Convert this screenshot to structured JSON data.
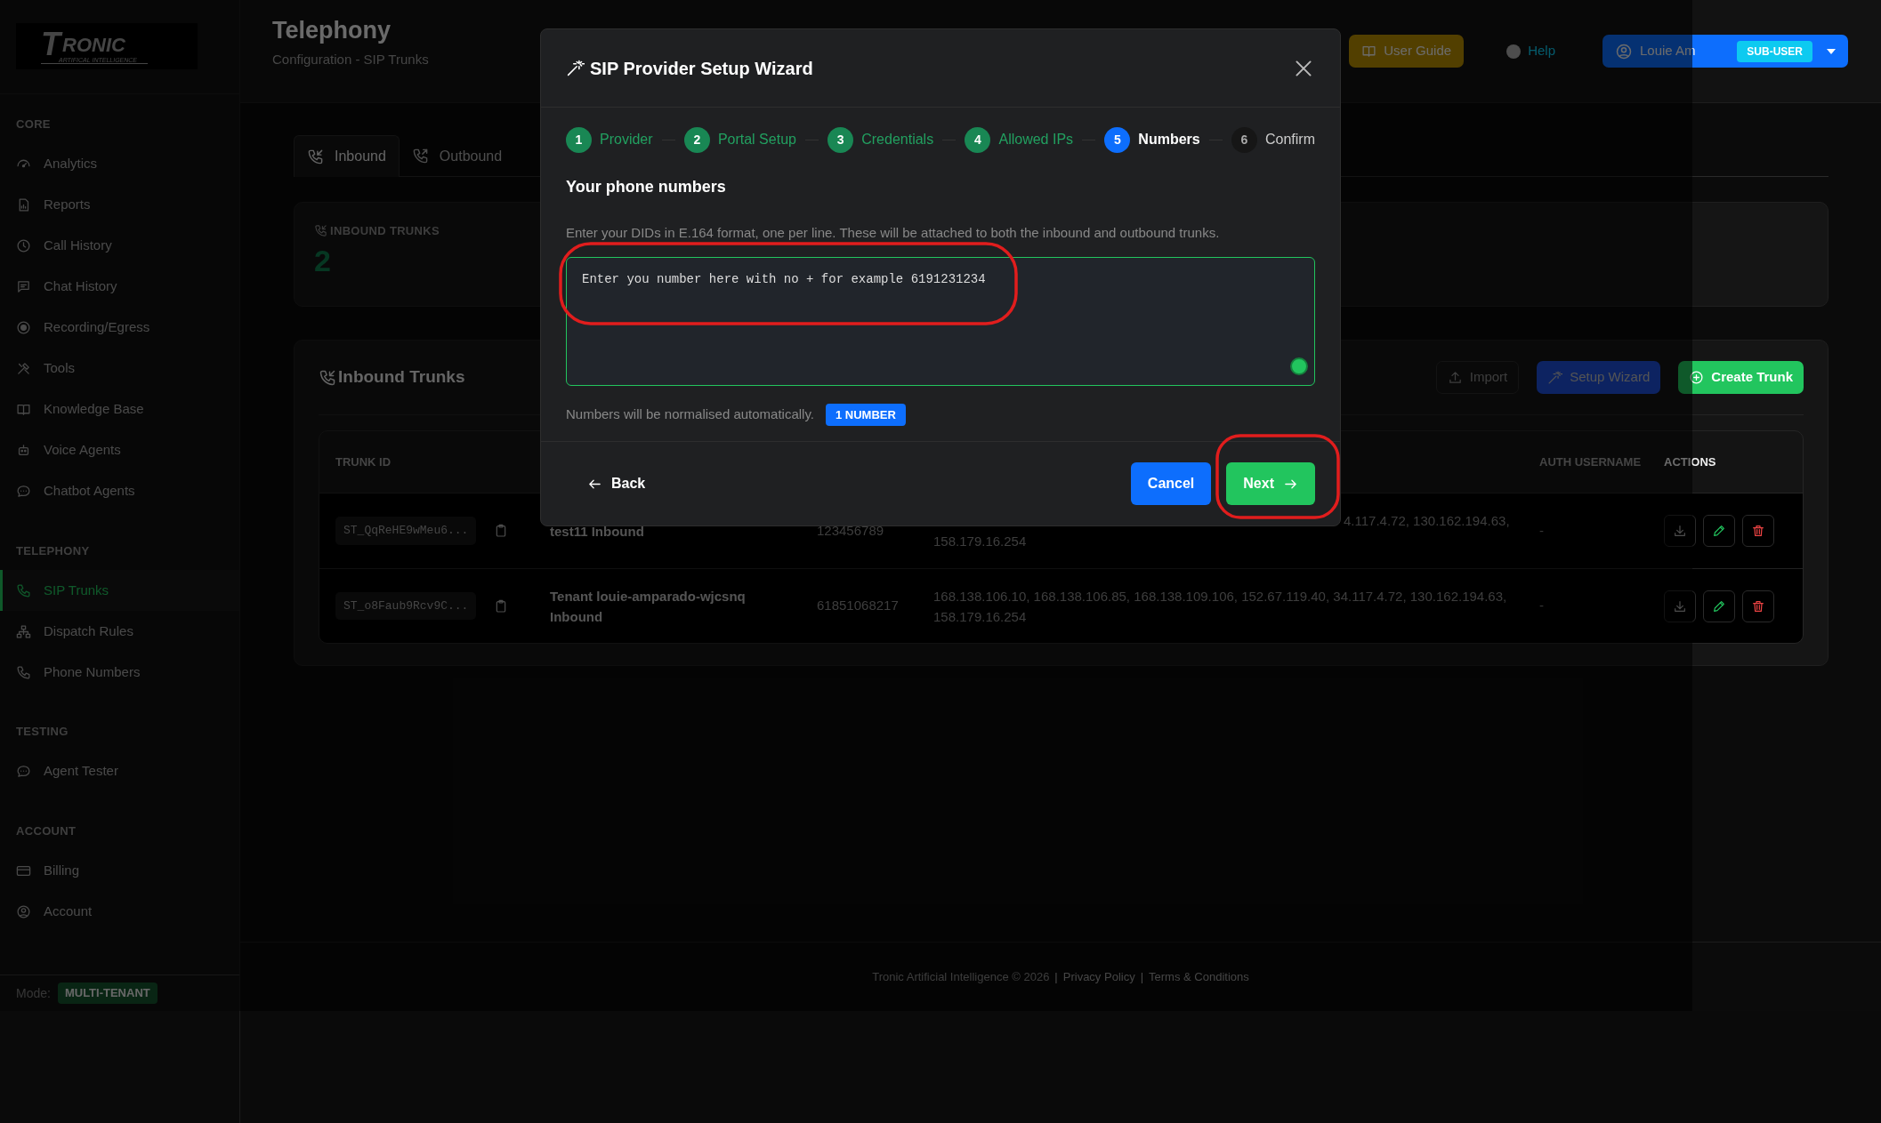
{
  "sidebar": {
    "logo_mark": "T",
    "logo_text": "RONIC",
    "logo_subtext": "ARTIFICAL INTELLIGENCE",
    "sections": [
      {
        "title": "CORE",
        "items": [
          {
            "label": "Analytics",
            "selected": false
          },
          {
            "label": "Reports",
            "selected": false
          },
          {
            "label": "Call History",
            "selected": false
          },
          {
            "label": "Chat History",
            "selected": false
          },
          {
            "label": "Recording/Egress",
            "selected": false
          },
          {
            "label": "Tools",
            "selected": false
          },
          {
            "label": "Knowledge Base",
            "selected": false
          },
          {
            "label": "Voice Agents",
            "selected": false
          },
          {
            "label": "Chatbot Agents",
            "selected": false
          }
        ]
      },
      {
        "title": "TELEPHONY",
        "items": [
          {
            "label": "SIP Trunks",
            "selected": true
          },
          {
            "label": "Dispatch Rules",
            "selected": false
          },
          {
            "label": "Phone Numbers",
            "selected": false
          }
        ]
      },
      {
        "title": "TESTING",
        "items": [
          {
            "label": "Agent Tester",
            "selected": false
          }
        ]
      },
      {
        "title": "ACCOUNT",
        "items": [
          {
            "label": "Billing",
            "selected": false
          },
          {
            "label": "Account",
            "selected": false
          }
        ]
      }
    ],
    "mode_label": "Mode:",
    "mode_badge": "MULTI-TENANT"
  },
  "header": {
    "title": "Telephony",
    "subtitle": "Configuration - SIP Trunks",
    "user_guide": "User Guide",
    "help": "Help",
    "user_name": "Louie Am",
    "role_badge": "SUB-USER"
  },
  "tabs": [
    {
      "label": "Inbound",
      "selected": true
    },
    {
      "label": "Outbound",
      "selected": false
    }
  ],
  "stat": {
    "label": "INBOUND TRUNKS",
    "value": "2"
  },
  "trunks_panel": {
    "title": "Inbound Trunks",
    "buttons": [
      {
        "kind": "outline",
        "label": "Import"
      },
      {
        "kind": "secondary",
        "label": "Setup Wizard"
      },
      {
        "kind": "primary",
        "label": "Create Trunk"
      }
    ],
    "table": {
      "columns": {
        "trunk_id": "TRUNK ID",
        "auth_username": "AUTH USERNAME",
        "actions": "ACTIONS"
      },
      "rows": [
        {
          "trunk_id": "ST_QqReHE9wMeu6...",
          "name": "test11 Inbound",
          "number": "123456789",
          "covered": true,
          "ip_lines": [
            "4.117.4.72, 130.162.194.63,",
            "158.179.16.254"
          ],
          "auth_username": "-"
        },
        {
          "trunk_id": "ST_o8Faub9Rcv9C...",
          "name": "Tenant louie-amparado-wjcsnq Inbound",
          "number": "61851068217",
          "covered": false,
          "ip_lines": [
            "168.138.106.10, 168.138.106.85, 168.138.109.106, 152.67.119.40, 34.117.4.72, 130.162.194.63,",
            "158.179.16.254"
          ],
          "auth_username": "-"
        }
      ]
    }
  },
  "footer": [
    {
      "kind": "text",
      "label": "Tronic Artificial Intelligence © 2026"
    },
    {
      "kind": "separator",
      "label": "|"
    },
    {
      "kind": "link",
      "label": "Privacy Policy"
    },
    {
      "kind": "separator",
      "label": "|"
    },
    {
      "kind": "link",
      "label": "Terms & Conditions"
    }
  ],
  "wizard": {
    "title": "SIP Provider Setup Wizard",
    "steps": [
      {
        "number": "1",
        "label": "Provider",
        "completed": true,
        "selected": false
      },
      {
        "number": "2",
        "label": "Portal Setup",
        "completed": true,
        "selected": false
      },
      {
        "number": "3",
        "label": "Credentials",
        "completed": true,
        "selected": false
      },
      {
        "number": "4",
        "label": "Allowed IPs",
        "completed": true,
        "selected": false
      },
      {
        "number": "5",
        "label": "Numbers",
        "completed": false,
        "selected": true
      },
      {
        "number": "6",
        "label": "Confirm",
        "completed": false,
        "selected": false
      }
    ],
    "section_title": "Your phone numbers",
    "description": "Enter your DIDs in E.164 format, one per line. These will be attached to both the inbound and outbound trunks.",
    "numbers_field": {
      "value": "Enter you number here with no + for example 6191231234"
    },
    "hint": "Numbers will be normalised automatically.",
    "count_badge": "1 NUMBER",
    "back": "Back",
    "cancel": "Cancel",
    "next": "Next"
  },
  "annotations": [
    {
      "kind": "freehand-ring"
    },
    {
      "kind": "freehand-ring"
    }
  ]
}
